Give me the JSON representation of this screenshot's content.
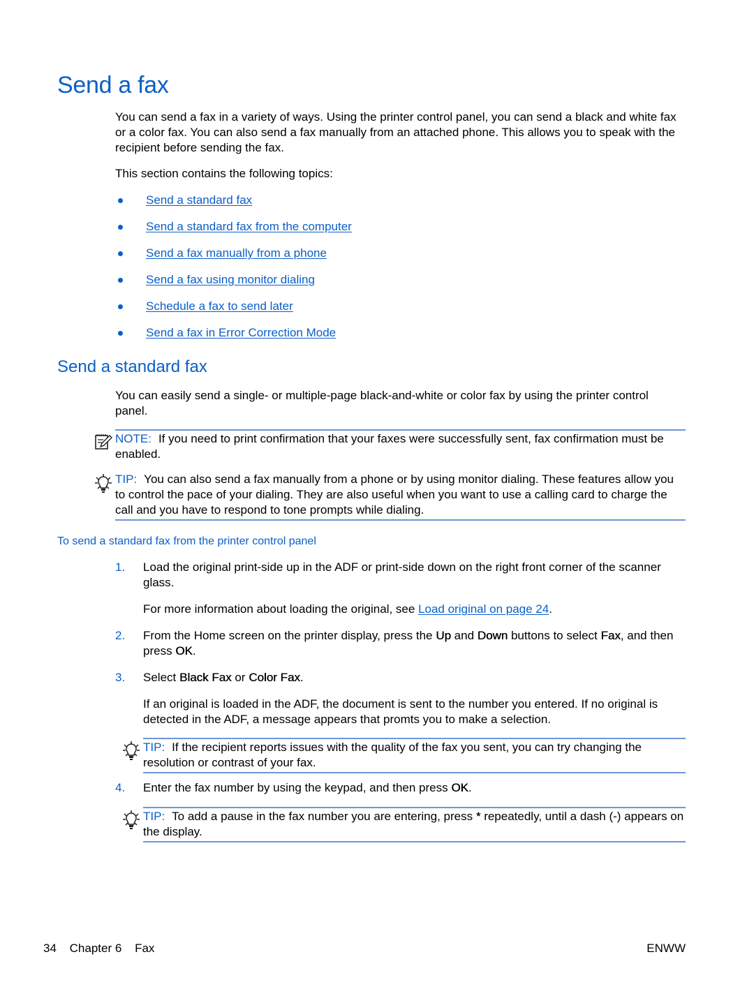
{
  "page": {
    "title": "Send a fax",
    "intro": "You can send a fax in a variety of ways. Using the printer control panel, you can send a black and white fax or a color fax. You can also send a fax manually from an attached phone. This allows you to speak with the recipient before sending the fax.",
    "topics_lead": "This section contains the following topics:",
    "topics": [
      "Send a standard fax",
      "Send a standard fax from the computer",
      "Send a fax manually from a phone",
      "Send a fax using monitor dialing",
      "Schedule a fax to send later",
      "Send a fax in Error Correction Mode"
    ]
  },
  "section": {
    "title": "Send a standard fax",
    "intro": "You can easily send a single- or multiple-page black-and-white or color fax by using the printer control panel.",
    "note": {
      "label": "NOTE:",
      "text": "If you need to print confirmation that your faxes were successfully sent, fax confirmation must be enabled."
    },
    "tip": {
      "label": "TIP:",
      "text": "You can also send a fax manually from a phone or by using monitor dialing. These features allow you to control the pace of your dialing. They are also useful when you want to use a calling card to charge the call and you have to respond to tone prompts while dialing."
    },
    "procedure_title": "To send a standard fax from the printer control panel",
    "steps": [
      {
        "num": "1.",
        "text": "Load the original print-side up in the ADF or print-side down on the right front corner of the scanner glass.",
        "sub_prefix": "For more information about loading the original, see ",
        "sub_link": "Load original on page 24",
        "sub_suffix": "."
      },
      {
        "num": "2.",
        "t1": "From the Home screen on the printer display, press the ",
        "k1": "Up",
        "t2": " and ",
        "k2": "Down",
        "t3": " buttons to select ",
        "k3": "Fax",
        "t4": ", and then press ",
        "k4": "OK",
        "t5": "."
      },
      {
        "num": "3.",
        "t1": "Select ",
        "k1": "Black Fax",
        "t2": " or ",
        "k2": "Color Fax",
        "t3": ".",
        "sub": "If an original is loaded in the ADF, the document is sent to the number you entered. If no original is detected in the ADF, a message appears that promts you to make a selection.",
        "tip_label": "TIP:",
        "tip_text": "If the recipient reports issues with the quality of the fax you sent, you can try changing the resolution or contrast of your fax."
      },
      {
        "num": "4.",
        "t1": "Enter the fax number by using the keypad, and then press ",
        "k1": "OK",
        "t2": ".",
        "tip_label": "TIP:",
        "tip_t1": "To add a pause in the fax number you are entering, press ",
        "tip_k1": "*",
        "tip_t2": " repeatedly, until a dash (-) appears on the display."
      }
    ]
  },
  "footer": {
    "page_number": "34",
    "chapter": "Chapter 6",
    "chapter_title": "Fax",
    "locale": "ENWW"
  },
  "colors": {
    "heading_blue": "#0a5fc8",
    "rule_blue": "#6b97d8"
  }
}
